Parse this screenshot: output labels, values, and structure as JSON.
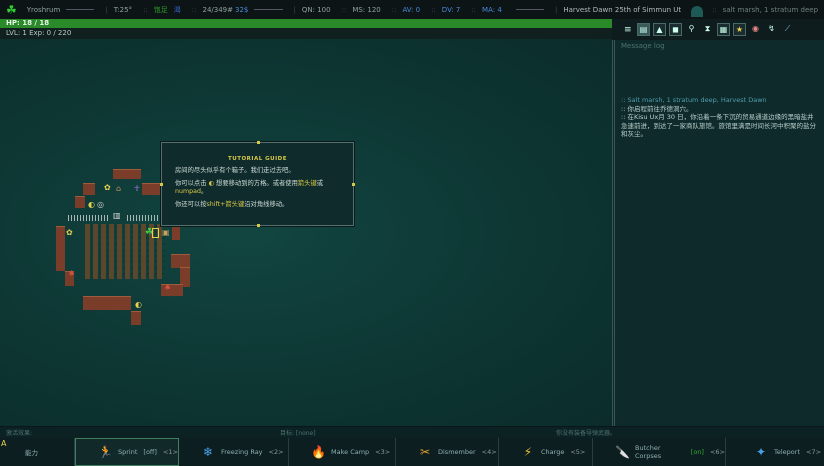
{
  "topbar": {
    "name": "Yroshrum",
    "temp": "T:25°",
    "hunger": "饱足",
    "thirst": "渴",
    "weight": "24/349#",
    "money": "32$",
    "qn": "QN: 100",
    "ms": "MS: 120",
    "av": "AV: 0",
    "dv": "DV: 7",
    "ma": "MA: 4",
    "date": "Harvest Dawn 25th of Simmun Ut",
    "location": "salt marsh, 1 stratum deep"
  },
  "stats": {
    "hp": "HP: 18 / 18",
    "hp_fraction": 1.0,
    "lvl": "LVL: 1 Exp: 0 / 220"
  },
  "toolbar": [
    "menu-icon",
    "inventory-lock-icon",
    "character-icon",
    "map-icon",
    "look-icon",
    "wait-icon",
    "journal-icon",
    "abilities-icon",
    "compass-icon",
    "rest-icon",
    "fire-icon"
  ],
  "log": {
    "title": "Message log",
    "messages": [
      ":: Salt marsh, 1 stratum deep, Harvest Dawn",
      ":: 你启程前往乔德洞穴。",
      ":: 在Kisu Ux月 30 日，你沿着一条下沉的贸易通道边缘的黑暗盐井急速前进，到达了一家商队旅馆。旅馆里满是时间长河中积聚的盐分和灰尘。"
    ]
  },
  "tutorial": {
    "title": "TUTORIAL GUIDE",
    "line1": "房间的尽头似乎有个箱子。我们走过去吧。",
    "line2a": "你可以点击",
    "line2b": "想要移动到的方格。或者使用",
    "line2c": "箭头键",
    "line2d": "或",
    "line2e": "numpad",
    "line2f": "。",
    "line3a": "你还可以按",
    "line3b": "shift+箭头键",
    "line3c": "沿对角线移动。"
  },
  "status": {
    "effects": "激活效果:",
    "target": "目标: [none]",
    "missile": "你没有装备导弹武器。"
  },
  "abilities": {
    "key": "A",
    "label": "能力",
    "items": [
      {
        "name": "Sprint",
        "state": "[off]",
        "key": "<1>",
        "icon": "🏃"
      },
      {
        "name": "Freezing Ray",
        "key": "<2>",
        "icon": "❄"
      },
      {
        "name": "Make Camp",
        "key": "<3>",
        "icon": "🔥"
      },
      {
        "name": "Dismember",
        "key": "<4>",
        "icon": "✂"
      },
      {
        "name": "Charge",
        "key": "<5>",
        "icon": "⚡"
      },
      {
        "name": "Butcher Corpses",
        "state": "[on]",
        "key": "<6>",
        "icon": "🔪"
      },
      {
        "name": "Teleport",
        "key": "<7>",
        "icon": "✦"
      }
    ]
  },
  "colors": {
    "hp": "#2a8a2a",
    "accent": "#d8c848",
    "brick": "#7a3d2a"
  }
}
